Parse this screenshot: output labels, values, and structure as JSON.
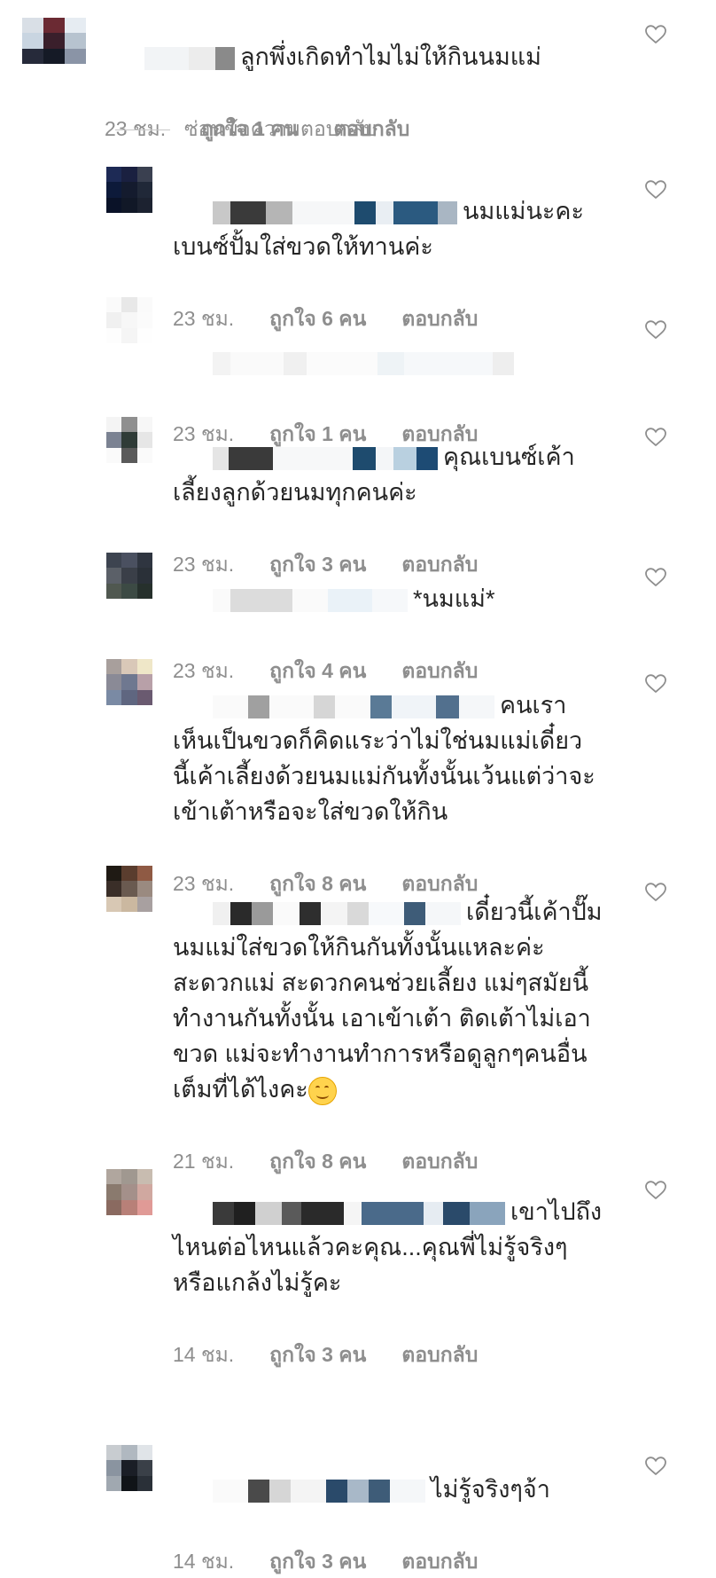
{
  "labels": {
    "like_prefix": "ถูกใจ",
    "like_suffix": "คน",
    "reply": "ตอบกลับ"
  },
  "hide_replies_label": "ซ่อนข้อความตอบกลับ",
  "comments": [
    {
      "text": "ลูกพึ่งเกิดทำไมไม่ให้กินนมแม่",
      "time": "23 ชม.",
      "likes": "1"
    },
    {
      "text": "นมแม่นะคะ\nเบนซ์ปั้มใส่ขวดให้ทานค่ะ",
      "time": "23 ชม.",
      "likes": "6"
    },
    {
      "text": "",
      "time": "23 ชม.",
      "likes": "1"
    },
    {
      "text": "คุณเบนซ์เค้า\nเลี้ยงลูกด้วยนมทุกคนค่ะ",
      "time": "23 ชม.",
      "likes": "3"
    },
    {
      "text": "*นมแม่*",
      "time": "23 ชม.",
      "likes": "4"
    },
    {
      "text": "คนเรา\nเห็นเป็นขวดก็คิดแระว่าไม่ใช่นมแม่เดี๋ยว\nนี้เค้าเลี้ยงด้วยนมแม่กันทั้งนั้นเว้นแต่ว่าจะ\nเข้าเต้าหรือจะใส่ขวดให้กิน",
      "time": "23 ชม.",
      "likes": "8"
    },
    {
      "text": "เดี๋ยวนี้เค้าปั๊ม\nนมแม่ใส่ขวดให้กินกันทั้งนั้นแหละค่ะ\nสะดวกแม่ สะดวกคนช่วยเลี้ยง แม่ๆสมัยนี้\nทำงานกันทั้งนั้น เอาเข้าเต้า ติดเต้าไม่เอา\nขวด แม่จะทำงานทำการหรือดูลูกๆคนอื่น\nเต็มที่ได้ไงคะ",
      "time": "21 ชม.",
      "likes": "8",
      "emoji": "smiling-face"
    },
    {
      "text": "เขาไปถึง\nไหนต่อไหนแล้วคะคุณ...คุณพี่ไม่รู้จริงๆ\nหรือแกล้งไม่รู้คะ",
      "time": "14 ชม.",
      "likes": "3"
    },
    {
      "text": "ไม่รู้จริงๆจ้า",
      "time": "14 ชม.",
      "likes": "3"
    }
  ],
  "colors": {
    "meta_text": "#8e8e8e",
    "body_text": "#262626",
    "heart_outline": "#8e8e8e"
  },
  "icons": {
    "like": "heart-outline-icon",
    "emoji": "smiling-face-emoji"
  }
}
